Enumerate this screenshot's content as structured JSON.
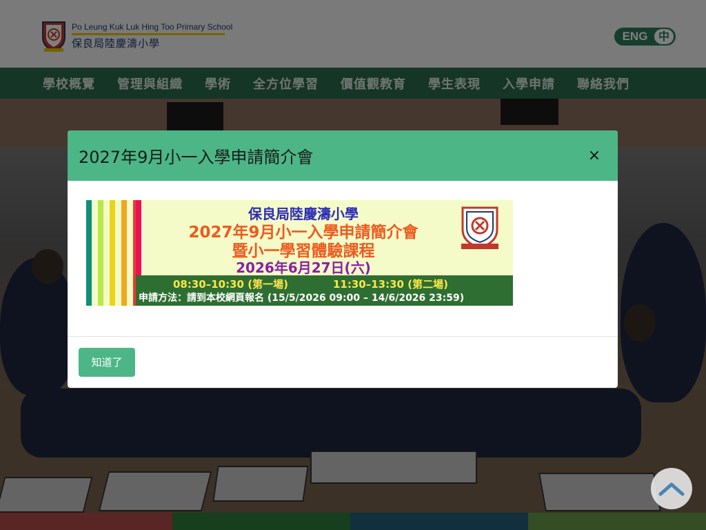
{
  "school": {
    "name_en": "Po Leung Kuk Luk Hing Too Primary School",
    "name_zh": "保良局陸慶濤小學"
  },
  "lang_toggle": {
    "eng": "ENG",
    "zh": "中"
  },
  "nav": {
    "items": [
      {
        "label": "學校概覽"
      },
      {
        "label": "管理與組織"
      },
      {
        "label": "學術"
      },
      {
        "label": "全方位學習"
      },
      {
        "label": "價值觀教育"
      },
      {
        "label": "學生表現"
      },
      {
        "label": "入學申請"
      },
      {
        "label": "聯絡我們"
      }
    ]
  },
  "modal": {
    "title": "2027年9月小一入學申請簡介會",
    "close_label": "×",
    "ok_label": "知道了",
    "banner": {
      "school": "保良局陸慶濤小學",
      "title": "2027年9月小一入學申請簡介會",
      "subtitle": "暨小一學習體驗課程",
      "date": "2026年6月27日(六)",
      "session1": "08:30–10:30 (第一場)",
      "session2": "11:30–13:30 (第二場)",
      "apply": "申請方法：請到本校網頁報名 (15/5/2026 09:00 – 14/6/2026 23:59)"
    }
  },
  "colors": {
    "nav_bg": "#2a6b4c",
    "modal_header": "#4cb686",
    "button": "#4cb686",
    "footer_strips": [
      "#b54a4a",
      "#2e7d3a",
      "#225e78",
      "#6a9a4a"
    ],
    "banner_stripes": [
      "#0e8f78",
      "#b7e84a",
      "#e8d51a",
      "#f0a818",
      "#e83d2a",
      "#e8115a"
    ]
  },
  "icons": {
    "crest": "school-crest-icon",
    "scroll_top": "chevron-up-icon"
  }
}
